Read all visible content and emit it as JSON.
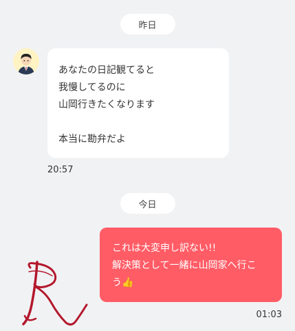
{
  "yesterday": {
    "date_label": "昨日",
    "message": {
      "lines": [
        "あなたの日記観てると",
        "我慢してるのに",
        "山岡行きたくなります",
        "",
        "本当に勘弁だよ"
      ],
      "time": "20:57"
    }
  },
  "today": {
    "date_label": "今日",
    "message": {
      "lines": [
        "これは大変申し訳ない!!",
        "解決策として一緒に山岡家へ行こ",
        "う👍"
      ],
      "time": "01:03"
    }
  },
  "colors": {
    "background": "#f1f2f4",
    "outgoing_bubble": "#ff5c66",
    "incoming_bubble": "#ffffff"
  }
}
